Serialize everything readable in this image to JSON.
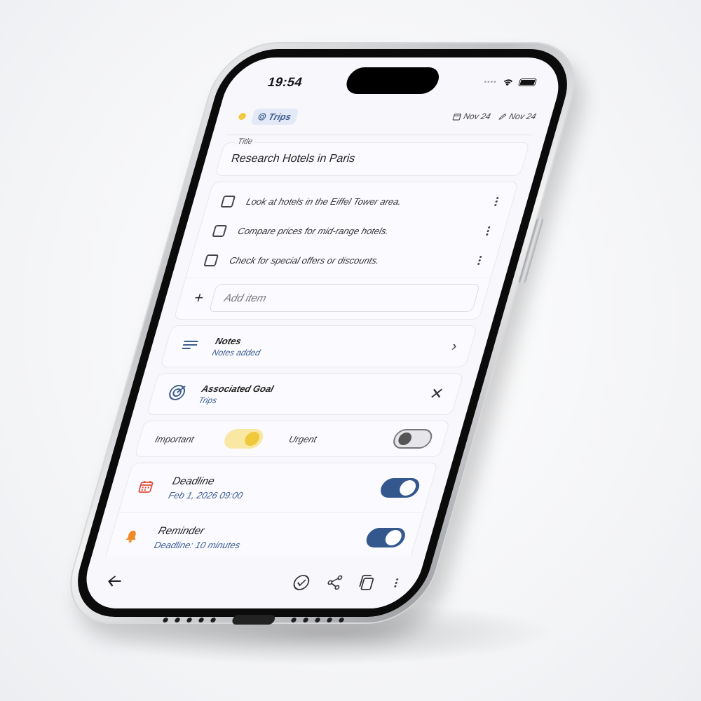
{
  "status_bar": {
    "time": "19:54",
    "signal": "••••"
  },
  "header": {
    "goal_chip": "Trips",
    "created_date": "Nov 24",
    "edited_date": "Nov 24",
    "colors": {
      "priority_dot": "#f2c83c",
      "accent": "#3d5d8f"
    }
  },
  "task": {
    "title_label": "Title",
    "title_value": "Research Hotels in Paris"
  },
  "checklist": {
    "items": [
      {
        "text": "Look at hotels in the Eiffel Tower area.",
        "checked": false
      },
      {
        "text": "Compare prices for mid-range hotels.",
        "checked": false
      },
      {
        "text": "Check for special offers or discounts.",
        "checked": false
      }
    ],
    "add_placeholder": "Add item"
  },
  "notes": {
    "title": "Notes",
    "subtitle": "Notes added"
  },
  "goal": {
    "title": "Associated Goal",
    "subtitle": "Trips"
  },
  "flags": {
    "important_label": "Important",
    "important_on": true,
    "urgent_label": "Urgent",
    "urgent_on": false
  },
  "deadline": {
    "title": "Deadline",
    "value": "Feb 1, 2026 09:00",
    "enabled": true
  },
  "reminder": {
    "title": "Reminder",
    "value": "Deadline: 10 minutes",
    "enabled": true
  },
  "icons": {
    "back": "arrow-left-icon",
    "complete": "check-circle-icon",
    "share": "share-icon",
    "copy": "copy-icon",
    "more": "more-vertical-icon"
  }
}
